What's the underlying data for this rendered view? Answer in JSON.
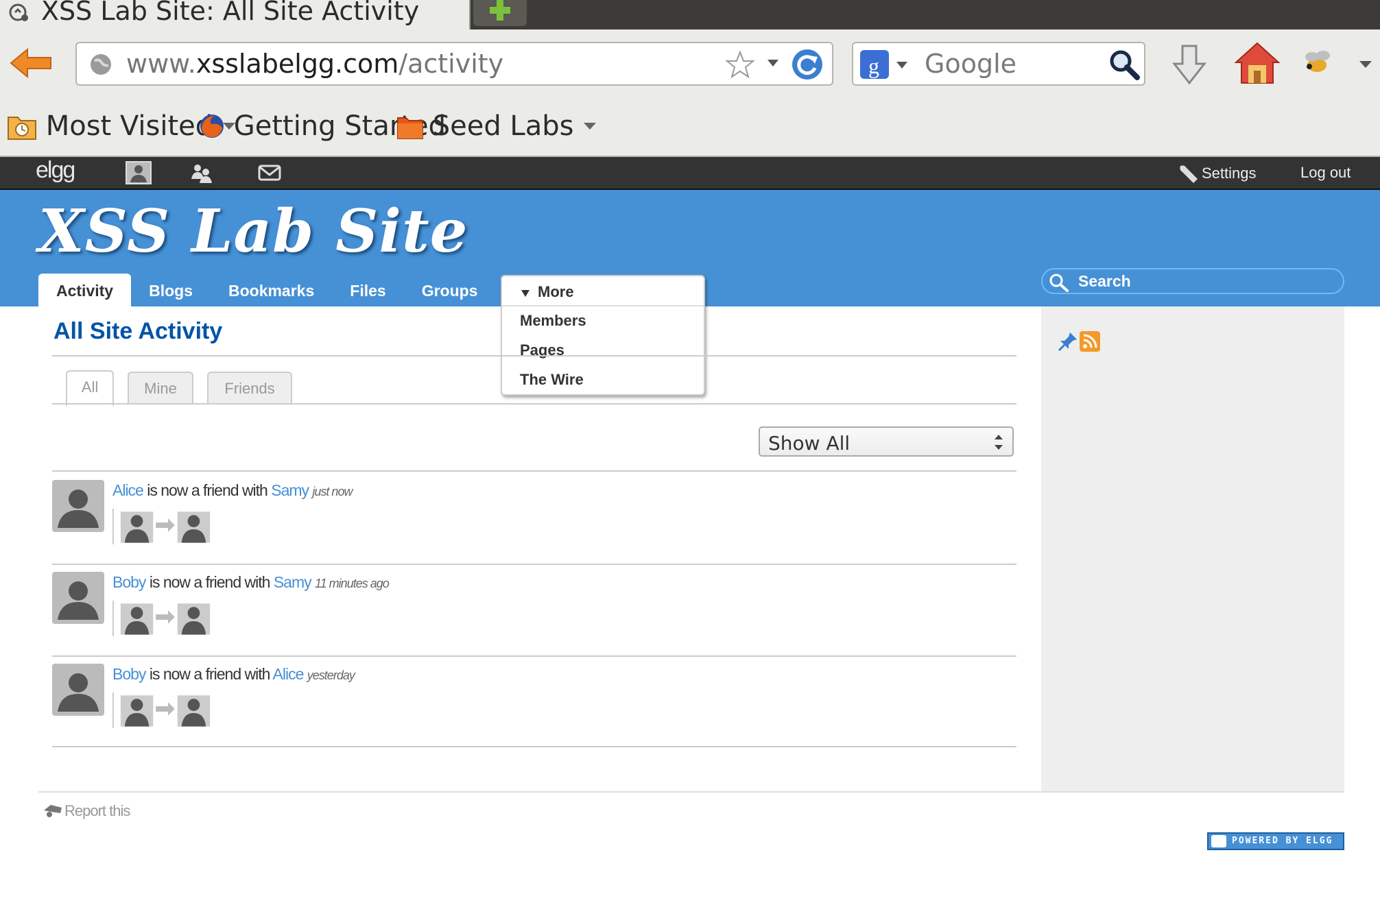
{
  "browser": {
    "tab_title": "XSS Lab Site: All Site Activity",
    "url_prefix": "www.",
    "url_domain": "xsslabelgg.com",
    "url_path": "/activity",
    "search_placeholder": "Google",
    "bookmarks": [
      {
        "label": "Most Visited",
        "icon": "folder-clock-icon"
      },
      {
        "label": "Getting Started",
        "icon": "firefox-icon"
      },
      {
        "label": "Seed Labs",
        "icon": "folder-icon"
      }
    ]
  },
  "topbar": {
    "logo": "elgg",
    "settings_label": "Settings",
    "logout_label": "Log out"
  },
  "header": {
    "site_title": "XSS Lab Site",
    "menu": [
      "Activity",
      "Blogs",
      "Bookmarks",
      "Files",
      "Groups"
    ],
    "more_label": "More",
    "more_items": [
      "Members",
      "Pages",
      "The Wire"
    ],
    "search_placeholder": "Search"
  },
  "main": {
    "page_title": "All Site Activity",
    "filter_tabs": [
      "All",
      "Mine",
      "Friends"
    ],
    "show_select": "Show All",
    "activity": [
      {
        "subject": "Alice",
        "verb": " is now a friend with ",
        "object": "Samy",
        "time": "just now"
      },
      {
        "subject": "Boby",
        "verb": " is now a friend with ",
        "object": "Samy",
        "time": "11 minutes ago"
      },
      {
        "subject": "Boby",
        "verb": " is now a friend with ",
        "object": "Alice",
        "time": "yesterday"
      }
    ]
  },
  "footer": {
    "report_label": "Report this",
    "powered_label": "POWERED BY ELGG"
  },
  "colors": {
    "elgg_blue": "#4690d6",
    "title_blue": "#0054a7",
    "topbar": "#333333",
    "sidebar": "#eeeeee"
  }
}
